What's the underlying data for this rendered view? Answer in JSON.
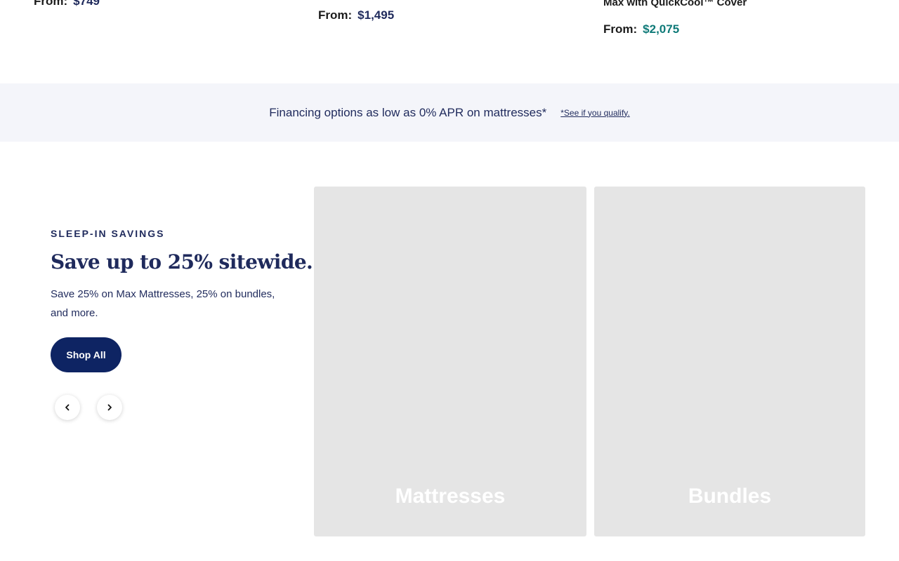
{
  "products": [
    {
      "title": "",
      "price_prefix": "From:",
      "price": "$749",
      "price_color": "#1f2a5c"
    },
    {
      "title": "",
      "price_prefix": "From:",
      "price": "$1,495",
      "price_color": "#1f2a5c"
    },
    {
      "title": "Max with QuickCool™ Cover",
      "price_prefix": "From:",
      "price": "$2,075",
      "price_color": "#0f7a78"
    }
  ],
  "financing": {
    "text": "Financing options as low as 0% APR on mattresses*",
    "link": "*See if you qualify."
  },
  "promo": {
    "eyebrow": "SLEEP-IN SAVINGS",
    "headline": "Save up to 25% sitewide.",
    "subtext": "Save 25% on Max Mattresses, 25% on bundles, and more.",
    "button_label": "Shop All"
  },
  "carousel": {
    "prev_icon": "chevron-left-icon",
    "next_icon": "chevron-right-icon",
    "cards": [
      {
        "label": "Mattresses"
      },
      {
        "label": "Bundles"
      }
    ]
  },
  "colors": {
    "navy": "#1f2a5c",
    "button": "#0e2463",
    "teal_price": "#0f7a78",
    "banner_bg": "#f4f5fa",
    "card_bg": "#e5e5e5"
  }
}
